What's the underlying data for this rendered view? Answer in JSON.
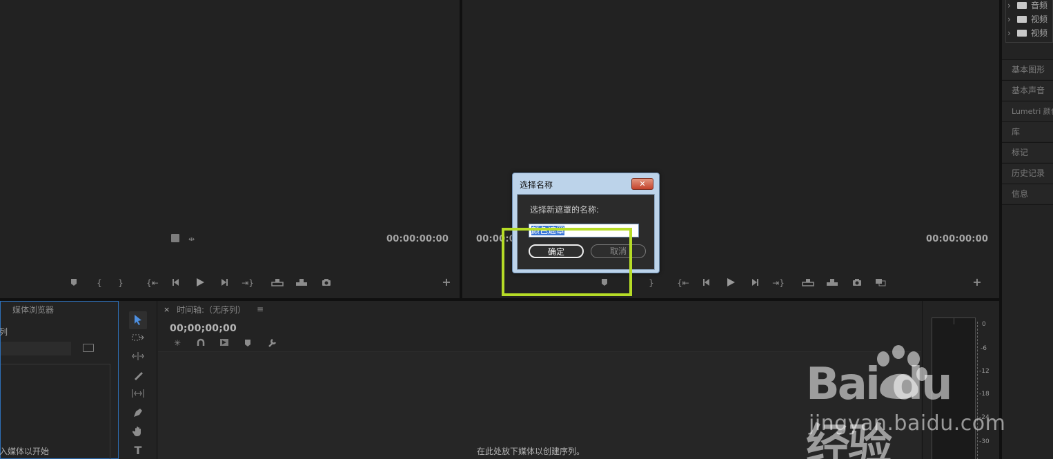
{
  "source_monitor": {
    "timecode_right": "00:00:00:00"
  },
  "program_monitor": {
    "timecode_left": "00:00:00",
    "timecode_right": "00:00:00:00"
  },
  "project_panel": {
    "tree": [
      {
        "label": "音频"
      },
      {
        "label": "视频"
      },
      {
        "label": "视频"
      }
    ]
  },
  "right_sidebar": {
    "items": [
      {
        "label": "基本图形"
      },
      {
        "label": "基本声音"
      },
      {
        "label": "Lumetri 颜色"
      },
      {
        "label": "库"
      },
      {
        "label": "标记"
      },
      {
        "label": "历史记录"
      },
      {
        "label": "信息"
      }
    ]
  },
  "media_browser": {
    "tab_label": "媒体浏览器",
    "row_label": "列",
    "hint": "入媒体以开始"
  },
  "timeline": {
    "close_label": "×",
    "tab_label": "时间轴:（无序列）",
    "menu_glyph": "≡",
    "timecode": "00;00;00;00",
    "drop_hint": "在此处放下媒体以创建序列。"
  },
  "audio_meter": {
    "scale": [
      "0",
      "-6",
      "-12",
      "-18",
      "-24",
      "-30"
    ]
  },
  "dialog": {
    "title": "选择名称",
    "close_label": "✕",
    "prompt": "选择新遮罩的名称:",
    "input_value": "颜色遮罩",
    "ok_label": "确定",
    "cancel_label": "取消"
  },
  "watermark": {
    "logo_text": "Bai du 经验",
    "url": "jingyan.baidu.com"
  },
  "colors": {
    "background": "#232323",
    "highlight": "#b6dc27",
    "selection": "#3875d7"
  }
}
